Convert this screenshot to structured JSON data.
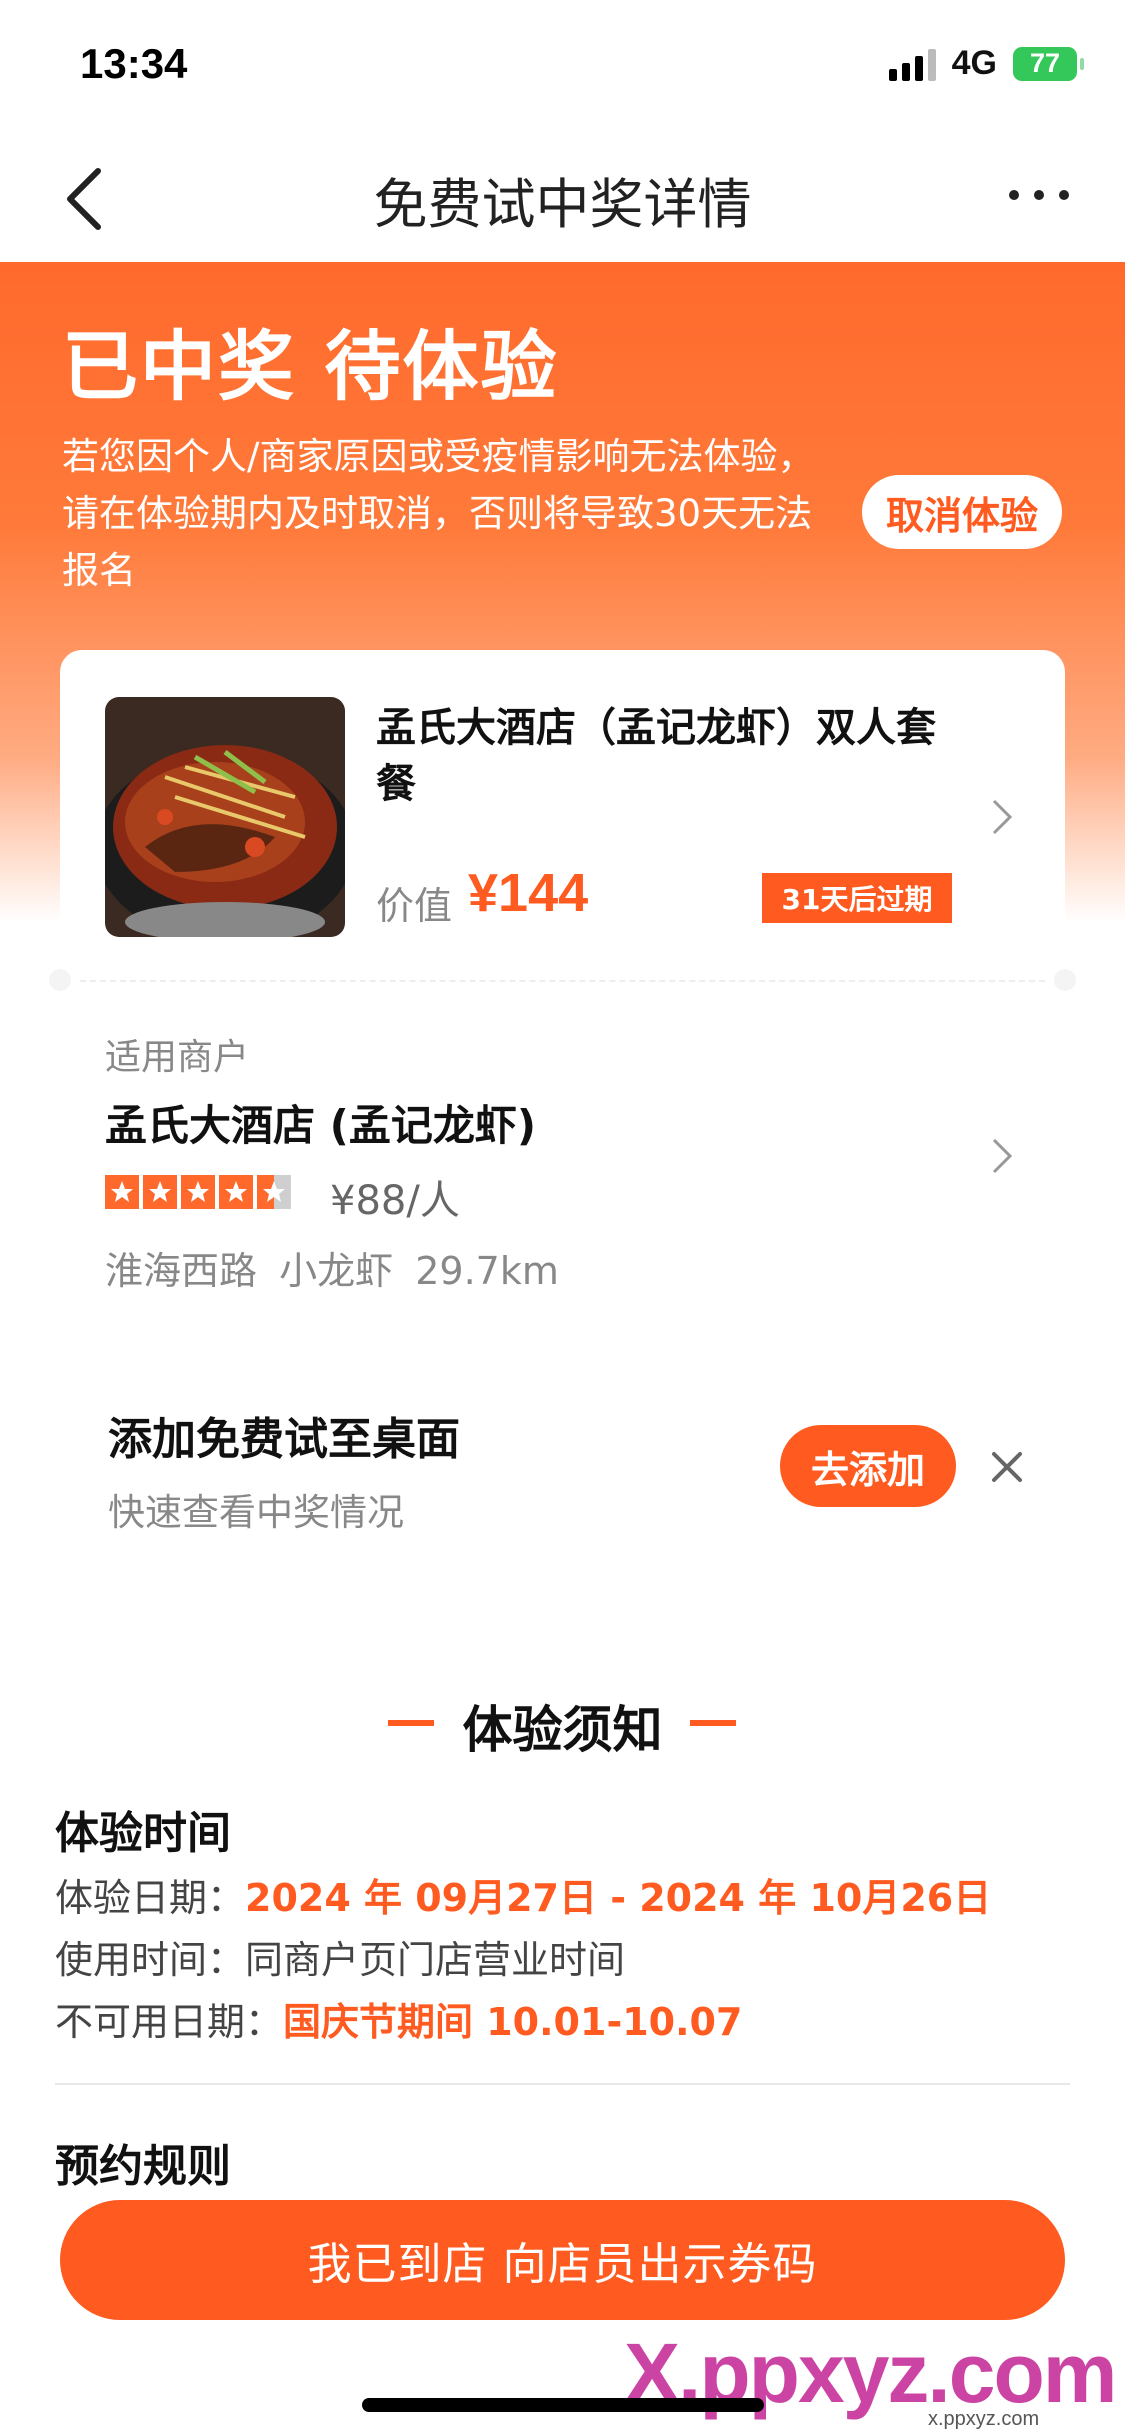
{
  "status_bar": {
    "time": "13:34",
    "network": "4G",
    "battery": "77"
  },
  "nav": {
    "title": "免费试中奖详情"
  },
  "banner": {
    "title": "已中奖 待体验",
    "description": "若您因个人/商家原因或受疫情影响无法体验，请在体验期内及时取消，否则将导致30天无法报名",
    "cancel_label": "取消体验"
  },
  "prize": {
    "name": "孟氏大酒店（孟记龙虾）双人套餐",
    "value_label": "价值",
    "price": "¥144",
    "expire": "31天后过期"
  },
  "merchant": {
    "section_label": "适用商户",
    "name": "孟氏大酒店 (孟记龙虾)",
    "rating": 4.5,
    "avg_price": "¥88/人",
    "area": "淮海西路",
    "category": "小龙虾",
    "distance": "29.7km"
  },
  "add_desktop": {
    "title": "添加免费试至桌面",
    "subtitle": "快速查看中奖情况",
    "button": "去添加"
  },
  "notice": {
    "title": "体验须知",
    "time_section": "体验时间",
    "rows": [
      {
        "label": "体验日期：",
        "value": "2024 年 09月27日 - 2024 年 10月26日"
      },
      {
        "label": "使用时间：",
        "value": "同商户页门店营业时间"
      },
      {
        "label": "不可用日期：",
        "value": "国庆节期间 10.01-10.07"
      }
    ],
    "booking_section": "预约规则"
  },
  "bottom": {
    "button": "我已到店 向店员出示券码"
  },
  "watermark": {
    "logo": "X.ppxyz.com",
    "sub": "x.ppxyz.com"
  },
  "colors": {
    "accent": "#ff5a1f",
    "banner_top": "#ff6a2c"
  }
}
